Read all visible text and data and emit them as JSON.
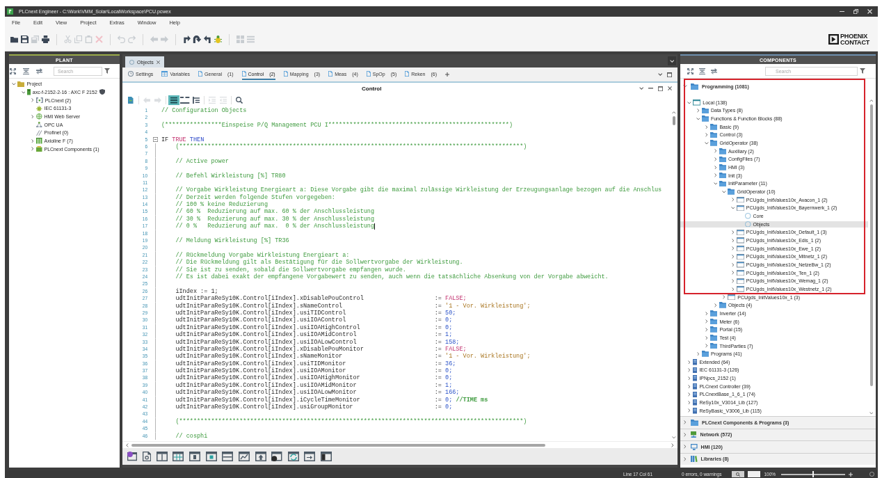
{
  "window": {
    "title": "PLCnext Engineer - C:\\Work\\VMM_Solar\\LocalWorkspace\\PCU.pcwex"
  },
  "menu": [
    "File",
    "Edit",
    "View",
    "Project",
    "Extras",
    "Window",
    "Help"
  ],
  "toolbar": [
    {
      "kind": "open",
      "disabled": false
    },
    {
      "kind": "save",
      "disabled": false
    },
    {
      "kind": "save_all",
      "disabled": true
    },
    {
      "kind": "printer",
      "disabled": false
    },
    {
      "kind": "separator"
    },
    {
      "kind": "cut",
      "disabled": true
    },
    {
      "kind": "copy",
      "disabled": true
    },
    {
      "kind": "paste",
      "disabled": true
    },
    {
      "kind": "delete",
      "disabled": true
    },
    {
      "kind": "separator"
    },
    {
      "kind": "undo",
      "disabled": true
    },
    {
      "kind": "redo",
      "disabled": true
    },
    {
      "kind": "separator"
    },
    {
      "kind": "back",
      "disabled": true
    },
    {
      "kind": "forward",
      "disabled": true
    },
    {
      "kind": "separator"
    },
    {
      "kind": "step_into",
      "disabled": false
    },
    {
      "kind": "step_over",
      "disabled": false
    },
    {
      "kind": "step_out",
      "disabled": false
    },
    {
      "kind": "debug",
      "disabled": false
    },
    {
      "kind": "separator"
    },
    {
      "kind": "grid",
      "disabled": true
    },
    {
      "kind": "list",
      "disabled": true
    }
  ],
  "logo": {
    "line_1": "PHOENIX",
    "line_2": "CONTACT"
  },
  "plant": {
    "title": "PLANT",
    "search": {
      "placeholder": "Search"
    },
    "tree": [
      {
        "label": "Project",
        "kind": "project",
        "expanded": true,
        "children": [
          {
            "label": "axc-f-2152-2-16 : AXC F 2152",
            "kind": "controller",
            "badge": {
              "kind": "shield"
            },
            "expanded": true,
            "children": [
              {
                "label": "PLCnext (2)",
                "kind": "plcnext",
                "expanded": false
              },
              {
                "label": "IEC 61131-3",
                "kind": "iec"
              },
              {
                "label": "HMI Web Server",
                "kind": "web",
                "expanded": false
              },
              {
                "label": "OPC UA",
                "kind": "opcua"
              },
              {
                "label": "Profinet (0)",
                "kind": "profinet"
              },
              {
                "label": "Axioline F (7)",
                "kind": "modules",
                "expanded": false
              },
              {
                "label": "PLCnext Components (1)",
                "kind": "components",
                "expanded": false
              }
            ]
          }
        ]
      }
    ]
  },
  "editor": {
    "tab": {
      "label": "Objects"
    },
    "subtabs": [
      {
        "label": "Settings",
        "kind": "settings",
        "selected": false
      },
      {
        "label": "Variables",
        "kind": "variables",
        "selected": false
      },
      {
        "label": "General",
        "count": "(1)",
        "kind": "sheet",
        "selected": false
      },
      {
        "label": "Control",
        "count": "(2)",
        "kind": "sheet",
        "selected": true
      },
      {
        "label": "Mapping",
        "count": "(3)",
        "kind": "sheet",
        "selected": false
      },
      {
        "label": "Meas",
        "count": "(4)",
        "kind": "sheet",
        "selected": false
      },
      {
        "label": "SpOp",
        "count": "(5)",
        "kind": "sheet",
        "selected": false
      },
      {
        "label": "Reken",
        "count": "(6)",
        "kind": "sheet",
        "selected": false
      }
    ],
    "title": "Control",
    "toolbar": [
      {
        "kind": "doc",
        "disabled": false,
        "active": false
      },
      {
        "kind": "separator"
      },
      {
        "kind": "back",
        "disabled": true,
        "active": false
      },
      {
        "kind": "forward",
        "disabled": true,
        "active": false
      },
      {
        "kind": "separator"
      },
      {
        "kind": "lines_view",
        "disabled": false,
        "active": true
      },
      {
        "kind": "collapse",
        "disabled": false,
        "active": false
      },
      {
        "kind": "tree",
        "disabled": false,
        "active": false
      },
      {
        "kind": "separator"
      },
      {
        "kind": "indent",
        "disabled": true,
        "active": false
      },
      {
        "kind": "outdent",
        "disabled": true,
        "active": false
      },
      {
        "kind": "separator"
      },
      {
        "kind": "search",
        "disabled": false,
        "active": false
      }
    ],
    "lines": [
      {
        "number": "1",
        "kind": "comment",
        "text": "// Configuration Objects"
      },
      {
        "number": "2",
        "kind": "blank"
      },
      {
        "number": "3",
        "kind": "comment",
        "text": "(****************Einspeise P/Q Management PCU I***************************************************)"
      },
      {
        "number": "4",
        "kind": "blank"
      },
      {
        "number": "5",
        "kind": "block",
        "expanded": true,
        "tokens": [
          {
            "kind": "plain",
            "text": "IF"
          },
          {
            "kind": "constant",
            "text": "TRUE"
          },
          {
            "kind": "keyword",
            "text": "THEN"
          }
        ],
        "children": [
          {
            "number": "6",
            "kind": "comment",
            "text": "(*************************************************************************************************)"
          },
          {
            "number": "7",
            "kind": "blank"
          },
          {
            "number": "8",
            "kind": "comment",
            "text": "// Active power"
          },
          {
            "number": "9",
            "kind": "blank"
          },
          {
            "number": "10",
            "kind": "comment",
            "text": "// Befehl Wirkleistung [%] TR80"
          },
          {
            "number": "11",
            "kind": "blank"
          },
          {
            "number": "12",
            "kind": "comment",
            "text": "// Vorgabe Wirkleistung Energieart a: Diese Vorgabe gibt die maximal zulässige Wirkleistung der Erzeugungsanlage bezogen auf die Anschlus"
          },
          {
            "number": "13",
            "kind": "comment",
            "text": "// Derzeit werden folgende Stufen vorgegeben:"
          },
          {
            "number": "14",
            "kind": "comment",
            "text": "// 100 % keine Reduzierung"
          },
          {
            "number": "15",
            "kind": "comment",
            "text": "// 60 %  Reduzierung auf max. 60 % der Anschlussleistung"
          },
          {
            "number": "16",
            "kind": "comment",
            "text": "// 30 %  Reduzierung auf max. 30 % der Anschlussleistung"
          },
          {
            "number": "17",
            "kind": "comment",
            "text": "// 0 %   Reduzierung auf max.  0 % der Anschlussleistung",
            "caret": true
          },
          {
            "number": "18",
            "kind": "blank"
          },
          {
            "number": "19",
            "kind": "comment",
            "text": "// Meldung Wirkleistung [%] TR36"
          },
          {
            "number": "20",
            "kind": "blank"
          },
          {
            "number": "21",
            "kind": "comment",
            "text": "// Rückmeldung Vorgabe Wirkleistung Energieart a:"
          },
          {
            "number": "22",
            "kind": "comment",
            "text": "// Die Rückmeldung gilt als Bestätigung für die Sollwertvorgabe der Wirkleistung."
          },
          {
            "number": "23",
            "kind": "comment",
            "text": "// Sie ist zu senden, sobald die Sollwertvorgabe empfangen wurde."
          },
          {
            "number": "24",
            "kind": "comment",
            "text": "// Es ist dabei exakt der empfangene Vorgabewert zu senden, auch wenn die tatsächliche Absenkung von der Vorgabe abweicht."
          },
          {
            "number": "25",
            "kind": "blank"
          },
          {
            "number": "26",
            "kind": "statement",
            "text": "iIndex := 1;"
          },
          {
            "number": "27",
            "kind": "assignment",
            "target": "udtInitParaReSy10K.Control[iIndex].xDisablePouControl",
            "op": ":=",
            "value": {
              "kind": "constant",
              "text": "FALSE;"
            }
          },
          {
            "number": "28",
            "kind": "assignment",
            "target": "udtInitParaReSy10K.Control[iIndex].sNameControl",
            "op": ":=",
            "value": {
              "kind": "string",
              "text": "'1 - Vor. Wirkleistung';"
            }
          },
          {
            "number": "29",
            "kind": "assignment",
            "target": "udtInitParaReSy10K.Control[iIndex].usiTIDControl",
            "op": ":=",
            "value": {
              "kind": "number",
              "text": "50;"
            }
          },
          {
            "number": "30",
            "kind": "assignment",
            "target": "udtInitParaReSy10K.Control[iIndex].usiIOAControl",
            "op": ":=",
            "value": {
              "kind": "number",
              "text": "0;"
            }
          },
          {
            "number": "31",
            "kind": "assignment",
            "target": "udtInitParaReSy10K.Control[iIndex].usiIOAHighControl",
            "op": ":=",
            "value": {
              "kind": "number",
              "text": "0;"
            }
          },
          {
            "number": "32",
            "kind": "assignment",
            "target": "udtInitParaReSy10K.Control[iIndex].usiIOAMidControl",
            "op": ":=",
            "value": {
              "kind": "number",
              "text": "1;"
            }
          },
          {
            "number": "33",
            "kind": "assignment",
            "target": "udtInitParaReSy10K.Control[iIndex].usiIOALowControl",
            "op": ":=",
            "value": {
              "kind": "number",
              "text": "158;"
            }
          },
          {
            "number": "34",
            "kind": "assignment",
            "target": "udtInitParaReSy10K.Control[iIndex].xDisablePouMonitor",
            "op": ":=",
            "value": {
              "kind": "constant",
              "text": "FALSE;"
            }
          },
          {
            "number": "35",
            "kind": "assignment",
            "target": "udtInitParaReSy10K.Control[iIndex].sNameMonitor",
            "op": ":=",
            "value": {
              "kind": "string",
              "text": "'1 - Vor. Wirkleistung';"
            }
          },
          {
            "number": "36",
            "kind": "assignment",
            "target": "udtInitParaReSy10K.Control[iIndex].usiTIDMonitor",
            "op": ":=",
            "value": {
              "kind": "number",
              "text": "36;"
            }
          },
          {
            "number": "37",
            "kind": "assignment",
            "target": "udtInitParaReSy10K.Control[iIndex].usiIOAMonitor",
            "op": ":=",
            "value": {
              "kind": "number",
              "text": "0;"
            }
          },
          {
            "number": "38",
            "kind": "assignment",
            "target": "udtInitParaReSy10K.Control[iIndex].usiIOAHighMonitor",
            "op": ":=",
            "value": {
              "kind": "number",
              "text": "0;"
            }
          },
          {
            "number": "39",
            "kind": "assignment",
            "target": "udtInitParaReSy10K.Control[iIndex].usiIOAMidMonitor",
            "op": ":=",
            "value": {
              "kind": "number",
              "text": "1;"
            }
          },
          {
            "number": "40",
            "kind": "assignment",
            "target": "udtInitParaReSy10K.Control[iIndex].usiIOALowMonitor",
            "op": ":=",
            "value": {
              "kind": "number",
              "text": "166;"
            }
          },
          {
            "number": "41",
            "kind": "assignment",
            "target": "udtInitParaReSy10K.Control[iIndex].iCycleTimeMonitor",
            "op": ":=",
            "value": {
              "kind": "number",
              "text": "0;"
            },
            "comment": "//TIME ms"
          },
          {
            "number": "42",
            "kind": "assignment",
            "target": "udtInitParaReSy10K.Control[iIndex].usiGroupMonitor",
            "op": ":=",
            "value": {
              "kind": "number",
              "text": "0;"
            }
          },
          {
            "number": "43",
            "kind": "blank"
          },
          {
            "number": "44",
            "kind": "comment",
            "text": "(*************************************************************************************************)"
          },
          {
            "number": "45",
            "kind": "blank"
          },
          {
            "number": "46",
            "kind": "comment",
            "text": "// cosphi"
          }
        ]
      }
    ],
    "bottom_toolbar": [
      {
        "kind": "gear_window"
      },
      {
        "kind": "search_document"
      },
      {
        "kind": "split_window"
      },
      {
        "kind": "grid_window"
      },
      {
        "kind": "column_window"
      },
      {
        "kind": "dot_window"
      },
      {
        "kind": "bar_window"
      },
      {
        "kind": "chart_window"
      },
      {
        "kind": "upload_window"
      },
      {
        "kind": "disc_window"
      },
      {
        "kind": "refresh_window"
      },
      {
        "kind": "arrow_window"
      },
      {
        "kind": "panel_window"
      }
    ]
  },
  "components": {
    "title": "COMPONENTS",
    "search": {
      "placeholder": "Search"
    },
    "sections": [
      {
        "label": "Programming (1081)",
        "kind": "folder",
        "expanded": true,
        "tree": [
          {
            "label": "Local (138)",
            "kind": "local",
            "expanded": true,
            "selected": false,
            "children": [
              {
                "label": "Data Types (8)",
                "kind": "folder",
                "expanded": false,
                "selected": false
              },
              {
                "label": "Functions & Function Blocks (88)",
                "kind": "folder",
                "expanded": true,
                "selected": false,
                "children": [
                  {
                    "label": "Basic (9)",
                    "kind": "folder",
                    "expanded": false,
                    "selected": false
                  },
                  {
                    "label": "Control (3)",
                    "kind": "folder",
                    "expanded": false,
                    "selected": false
                  },
                  {
                    "label": "GridOperator (38)",
                    "kind": "folder",
                    "expanded": true,
                    "selected": false,
                    "children": [
                      {
                        "label": "Auxiliary (2)",
                        "kind": "folder",
                        "expanded": false,
                        "selected": false
                      },
                      {
                        "label": "ConfigFiles (7)",
                        "kind": "folder",
                        "expanded": false,
                        "selected": false
                      },
                      {
                        "label": "HMI (3)",
                        "kind": "folder",
                        "expanded": false,
                        "selected": false
                      },
                      {
                        "label": "Init (3)",
                        "kind": "folder",
                        "expanded": false,
                        "selected": false
                      },
                      {
                        "label": "InitParameter (11)",
                        "kind": "folder",
                        "expanded": true,
                        "selected": false,
                        "children": [
                          {
                            "label": "GridOperator (10)",
                            "kind": "folder",
                            "expanded": true,
                            "selected": false,
                            "children": [
                              {
                                "label": "PCUgds_InitValues10x_Avacon_1 (2)",
                                "kind": "fb",
                                "expanded": false,
                                "selected": false
                              },
                              {
                                "label": "PCUgds_InitValues10x_Bayernwerk_1 (2)",
                                "kind": "fb",
                                "expanded": true,
                                "selected": false,
                                "children": [
                                  {
                                    "label": "Core",
                                    "kind": "code",
                                    "selected": false
                                  },
                                  {
                                    "label": "Objects",
                                    "kind": "code",
                                    "selected": true
                                  }
                                ]
                              },
                              {
                                "label": "PCUgds_InitValues10x_Default_1 (3)",
                                "kind": "fb",
                                "expanded": false,
                                "selected": false
                              },
                              {
                                "label": "PCUgds_InitValues10x_Edis_1 (2)",
                                "kind": "fb",
                                "expanded": false,
                                "selected": false
                              },
                              {
                                "label": "PCUgds_InitValues10x_Ewe_1 (2)",
                                "kind": "fb",
                                "expanded": false,
                                "selected": false
                              },
                              {
                                "label": "PCUgds_InitValues10x_Mitnetz_1 (2)",
                                "kind": "fb",
                                "expanded": false,
                                "selected": false
                              },
                              {
                                "label": "PCUgds_InitValues10x_NetzeBw_1 (2)",
                                "kind": "fb",
                                "expanded": false,
                                "selected": false
                              },
                              {
                                "label": "PCUgds_InitValues10x_Ten_1 (2)",
                                "kind": "fb",
                                "expanded": false,
                                "selected": false
                              },
                              {
                                "label": "PCUgds_InitValues10x_Wemag_1 (2)",
                                "kind": "fb",
                                "expanded": false,
                                "selected": false
                              },
                              {
                                "label": "PCUgds_InitValues10x_Westnetz_1 (2)",
                                "kind": "fb",
                                "expanded": false,
                                "selected": false
                              }
                            ]
                          },
                          {
                            "label": "PCUgds_InitValues10x_1 (3)",
                            "kind": "fb",
                            "expanded": false,
                            "selected": false
                          }
                        ]
                      },
                      {
                        "label": "Objects (4)",
                        "kind": "folder",
                        "expanded": false,
                        "selected": false
                      }
                    ]
                  },
                  {
                    "label": "Inverter (14)",
                    "kind": "folder",
                    "expanded": false,
                    "selected": false
                  },
                  {
                    "label": "Meter (6)",
                    "kind": "folder",
                    "expanded": false,
                    "selected": false
                  },
                  {
                    "label": "Portal (15)",
                    "kind": "folder",
                    "expanded": false,
                    "selected": false
                  },
                  {
                    "label": "Test (4)",
                    "kind": "folder",
                    "expanded": false,
                    "selected": false
                  },
                  {
                    "label": "ThirdParties (7)",
                    "kind": "folder",
                    "expanded": false,
                    "selected": false
                  }
                ]
              },
              {
                "label": "Programs (41)",
                "kind": "folder",
                "expanded": false,
                "selected": false
              }
            ]
          },
          {
            "label": "Extended (64)",
            "kind": "library",
            "expanded": false,
            "selected": false
          },
          {
            "label": "IEC 61131-3 (126)",
            "kind": "library",
            "expanded": false,
            "selected": false
          },
          {
            "label": "IPNpcs_2152 (1)",
            "kind": "library",
            "expanded": false,
            "selected": false
          },
          {
            "label": "PLCnext Controller (39)",
            "kind": "library",
            "expanded": false,
            "selected": false
          },
          {
            "label": "PLCnextBase_1_6_1 (74)",
            "kind": "library",
            "expanded": false,
            "selected": false
          },
          {
            "label": "ReSy10x_V3014_Lib (127)",
            "kind": "library",
            "expanded": false,
            "selected": false
          },
          {
            "label": "ReSyBasic_V3006_Lib (115)",
            "kind": "library",
            "expanded": false,
            "selected": false
          }
        ]
      },
      {
        "label": "PLCnext Components & Programs (3)",
        "kind": "folder",
        "expanded": false
      },
      {
        "label": "Network (572)",
        "kind": "network",
        "expanded": false
      },
      {
        "label": "HMI (120)",
        "kind": "hmi",
        "expanded": false
      },
      {
        "label": "Libraries (8)",
        "kind": "libraries",
        "expanded": false
      }
    ]
  },
  "status_bar": {
    "position": "Line 17 Col 61",
    "messages": "0 errors, 0 warnings",
    "zoom": "100%",
    "zoom_slider": {
      "level": 0.5
    }
  }
}
